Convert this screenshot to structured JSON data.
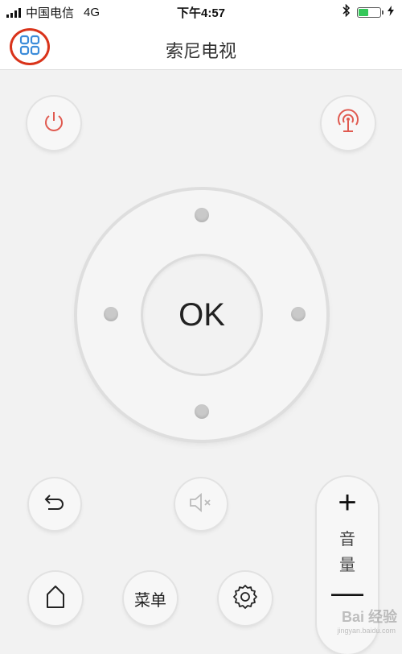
{
  "status_bar": {
    "carrier": "中国电信",
    "network": "4G",
    "time": "下午4:57",
    "bluetooth_icon": "bluetooth-icon",
    "battery_level": 0.5
  },
  "nav": {
    "title": "索尼电视",
    "menu_icon": "grid-icon"
  },
  "controls": {
    "power_icon": "power-icon",
    "cast_icon": "broadcast-icon",
    "ok_label": "OK",
    "back_icon": "back-arrow-icon",
    "mute_icon": "mute-icon",
    "home_icon": "home-icon",
    "menu_label": "菜单",
    "settings_icon": "gear-icon",
    "volume_plus": "+",
    "volume_label": "音量",
    "volume_minus": "—"
  },
  "colors": {
    "accent_red": "#e05a50",
    "menu_blue": "#3b8bd9",
    "highlight_circle": "#d9331a"
  },
  "watermark": {
    "text": "Bai 经验",
    "sub": "jingyan.baidu.com"
  }
}
